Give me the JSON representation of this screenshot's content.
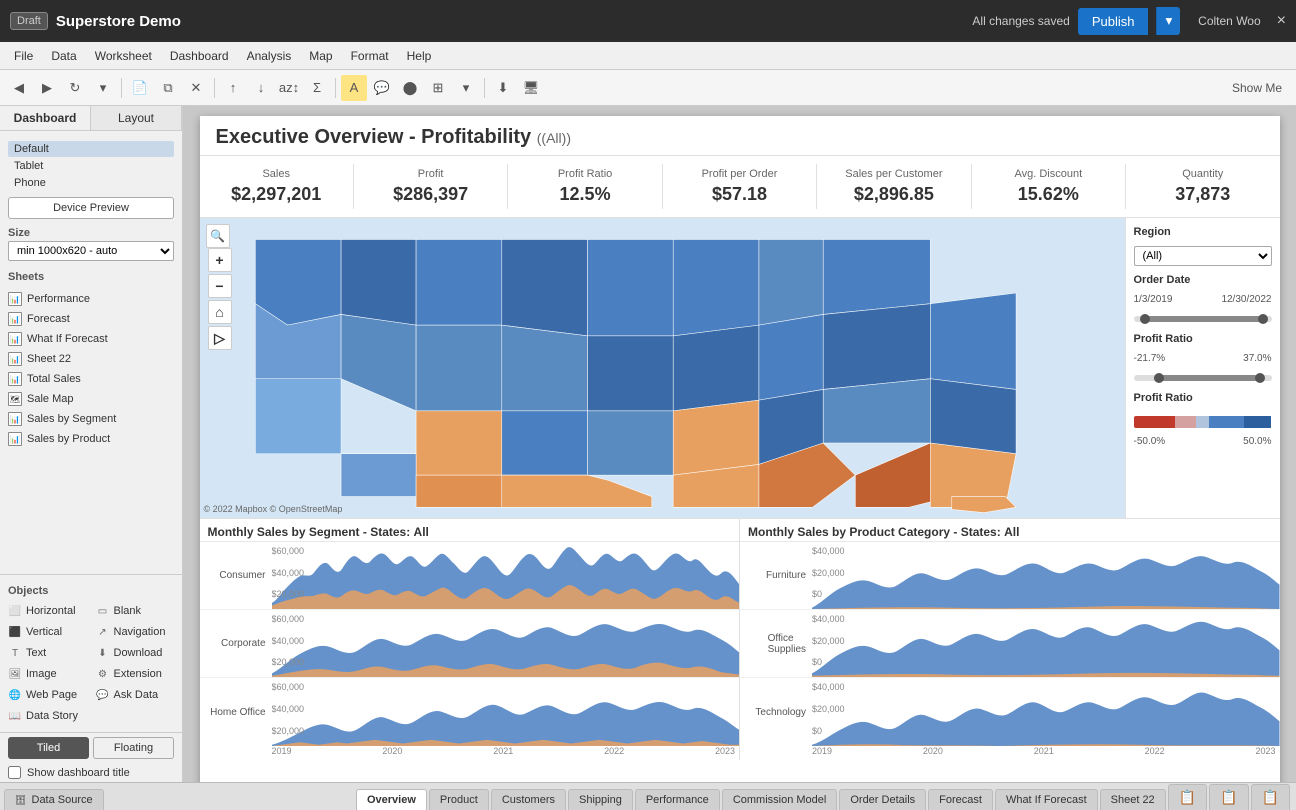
{
  "topbar": {
    "draft_label": "Draft",
    "title": "Superstore Demo",
    "saved_text": "All changes saved",
    "publish_label": "Publish",
    "user_name": "Colten Woo",
    "close_icon": "×"
  },
  "menubar": {
    "items": [
      "File",
      "Data",
      "Worksheet",
      "Dashboard",
      "Analysis",
      "Map",
      "Format",
      "Help"
    ]
  },
  "left_panel": {
    "tabs": [
      "Dashboard",
      "Layout"
    ],
    "device_options": [
      "Default",
      "Tablet",
      "Phone"
    ],
    "device_preview_label": "Device Preview",
    "size_label": "Size",
    "size_option": "min 1000x620 - auto",
    "sheets_label": "Sheets",
    "sheets": [
      "Performance",
      "Forecast",
      "What If Forecast",
      "Sheet 22",
      "Total Sales",
      "Sale Map",
      "Sales by Segment",
      "Sales by Product"
    ],
    "objects_label": "Objects",
    "objects": [
      {
        "name": "Horizontal",
        "icon": "⬜"
      },
      {
        "name": "Blank",
        "icon": "▭"
      },
      {
        "name": "Vertical",
        "icon": "⬛"
      },
      {
        "name": "Navigation",
        "icon": "🧭"
      },
      {
        "name": "Text",
        "icon": "T"
      },
      {
        "name": "Download",
        "icon": "⬇"
      },
      {
        "name": "Image",
        "icon": "🖼"
      },
      {
        "name": "Extension",
        "icon": "⚙"
      },
      {
        "name": "Web Page",
        "icon": "🌐"
      },
      {
        "name": "Ask Data",
        "icon": "💬"
      },
      {
        "name": "Data Story",
        "icon": "📖"
      }
    ],
    "tiled_label": "Tiled",
    "floating_label": "Floating",
    "show_title_label": "Show dashboard title"
  },
  "dashboard": {
    "title": "Executive Overview - Profitability",
    "filter_label": "(All)",
    "kpis": [
      {
        "label": "Sales",
        "value": "$2,297,201"
      },
      {
        "label": "Profit",
        "value": "$286,397"
      },
      {
        "label": "Profit Ratio",
        "value": "12.5%"
      },
      {
        "label": "Profit per Order",
        "value": "$57.18"
      },
      {
        "label": "Sales per Customer",
        "value": "$2,896.85"
      },
      {
        "label": "Avg. Discount",
        "value": "15.62%"
      },
      {
        "label": "Quantity",
        "value": "37,873"
      }
    ],
    "map_copyright": "© 2022 Mapbox  © OpenStreetMap",
    "filters": {
      "region_label": "Region",
      "region_value": "(All)",
      "order_date_label": "Order Date",
      "date_start": "1/3/2019",
      "date_end": "12/30/2022",
      "profit_ratio_label": "Profit Ratio",
      "profit_ratio_min": "-21.7%",
      "profit_ratio_max": "37.0%",
      "profit_ratio_bar_label": "Profit Ratio",
      "bar_min": "-50.0%",
      "bar_max": "50.0%"
    },
    "segment_chart": {
      "title_prefix": "Monthly Sales by Segment - States: ",
      "state_label": "All",
      "rows": [
        {
          "label": "Consumer",
          "y_max": "$60,000",
          "y_mid": "$40,000",
          "y_min": "$20,000"
        },
        {
          "label": "Corporate",
          "y_max": "$60,000",
          "y_mid": "$40,000",
          "y_min": "$20,000"
        },
        {
          "label": "Home Office",
          "y_max": "$60,000",
          "y_mid": "$40,000",
          "y_min": "$20,000"
        }
      ],
      "x_labels": [
        "2019",
        "2020",
        "2021",
        "2022",
        "2023"
      ]
    },
    "product_chart": {
      "title_prefix": "Monthly Sales by Product Category - States: ",
      "state_label": "All",
      "rows": [
        {
          "label": "Furniture",
          "y_max": "$40,000",
          "y_mid": "$20,000",
          "y_min": "$0"
        },
        {
          "label": "Office Supplies",
          "y_max": "$40,000",
          "y_mid": "$20,000",
          "y_min": "$0"
        },
        {
          "label": "Technology",
          "y_max": "$40,000",
          "y_mid": "$20,000",
          "y_min": "$0"
        }
      ],
      "x_labels": [
        "2019",
        "2020",
        "2021",
        "2022",
        "2023"
      ]
    }
  },
  "bottom_tabs": {
    "datasource_label": "Data Source",
    "tabs": [
      "Overview",
      "Product",
      "Customers",
      "Shipping",
      "Performance",
      "Commission Model",
      "Order Details",
      "Forecast",
      "What If Forecast",
      "Sheet 22"
    ]
  }
}
